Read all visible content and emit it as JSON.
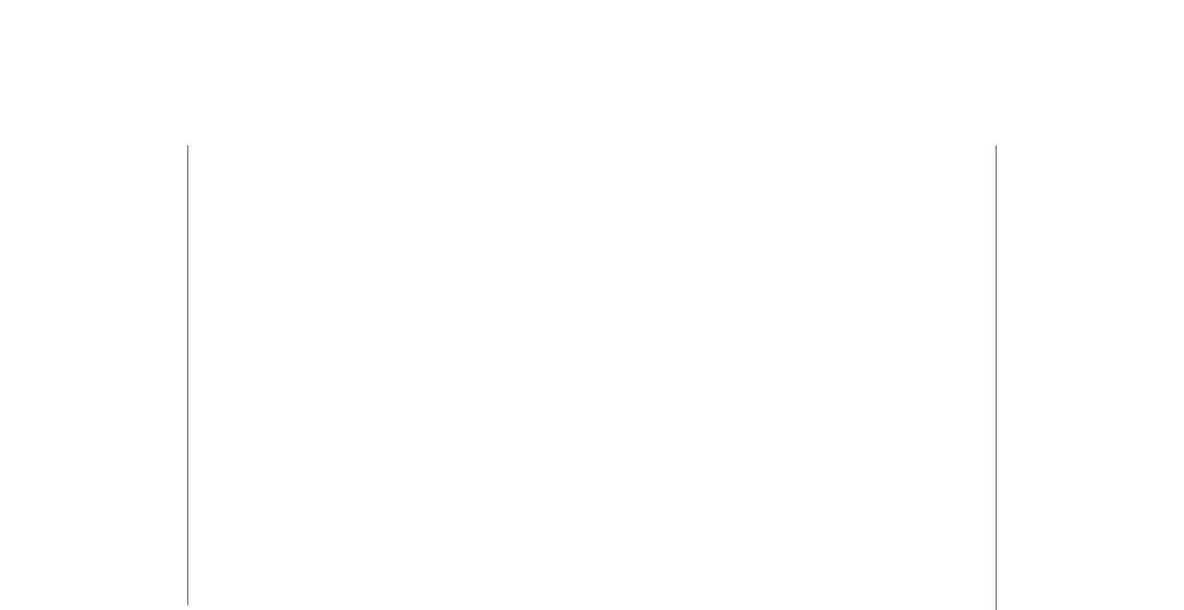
{
  "page": {
    "background_color": "#ffffff",
    "border_color": "#8c8c8c"
  },
  "content_frame": {
    "state": "blank"
  }
}
